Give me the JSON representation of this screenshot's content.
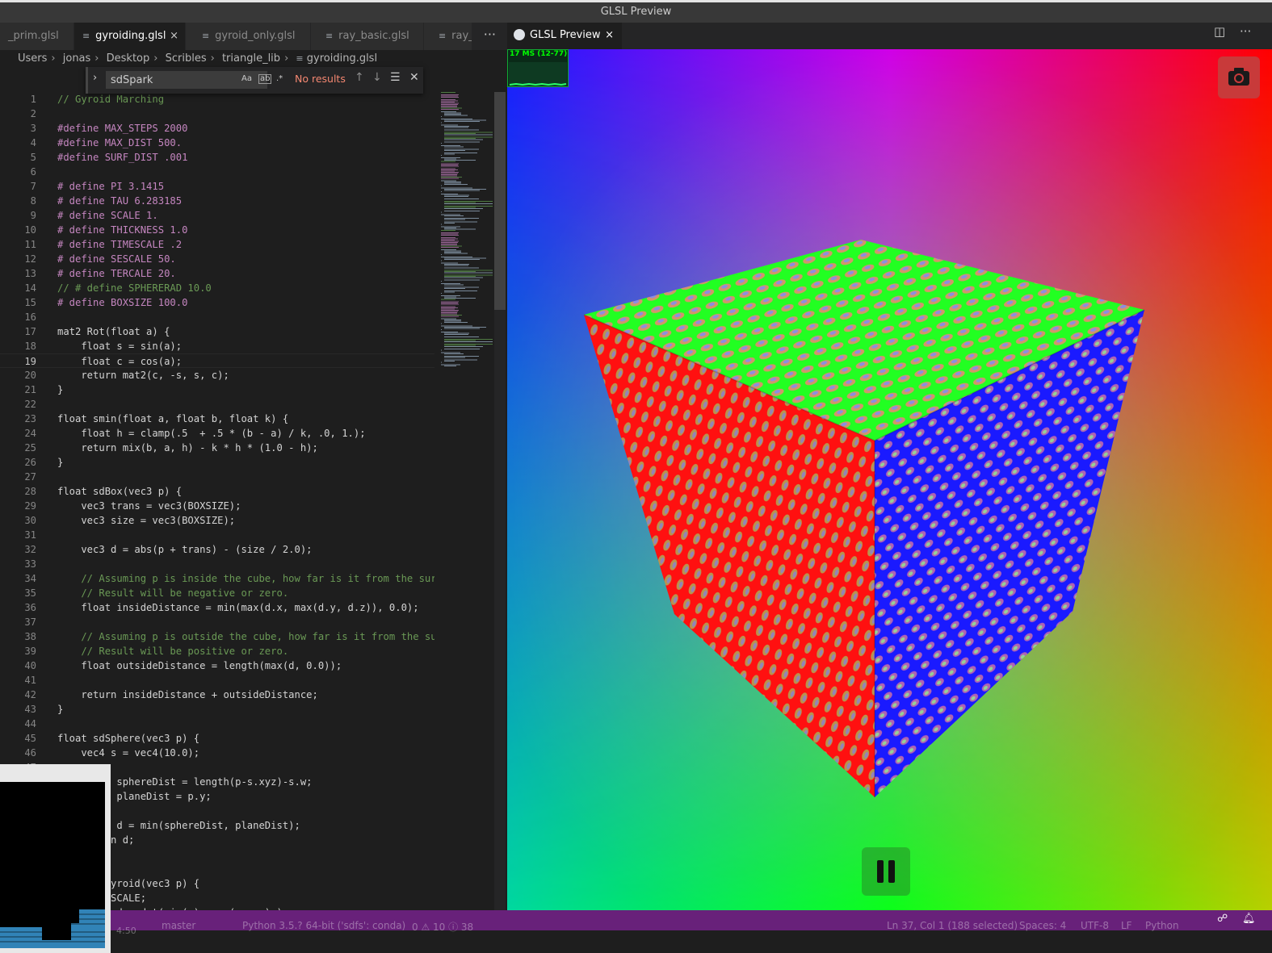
{
  "window": {
    "title": "GLSL Preview"
  },
  "editor": {
    "tabs": [
      {
        "label": "_prim.glsl",
        "active": false
      },
      {
        "label": "gyroiding.glsl",
        "active": true
      },
      {
        "label": "gyroid_only.glsl",
        "active": false
      },
      {
        "label": "ray_basic.glsl",
        "active": false
      },
      {
        "label": "ray_",
        "active": false
      }
    ],
    "tab_close": "×",
    "more": "···",
    "breadcrumb": [
      "Users",
      "jonas",
      "Desktop",
      "Scribles",
      "triangle_lib",
      "gyroiding.glsl"
    ],
    "find": {
      "value": "sdSpark",
      "opt_case": "Aa",
      "opt_word": "ab",
      "opt_regex": ".*",
      "results": "No results",
      "prev": "↑",
      "next": "↓",
      "selection": "☰",
      "close": "✕"
    },
    "current_line": 19,
    "lines": [
      "// Gyroid Marching",
      "",
      "#define MAX_STEPS 2000",
      "#define MAX_DIST 500.",
      "#define SURF_DIST .001",
      "",
      "# define PI 3.1415",
      "# define TAU 6.283185",
      "# define SCALE 1.",
      "# define THICKNESS 1.0",
      "# define TIMESCALE .2",
      "# define SESCALE 50.",
      "# define TERCALE 20.",
      "// # define SPHERERAD 10.0",
      "# define BOXSIZE 100.0",
      "",
      "mat2 Rot(float a) {",
      "    float s = sin(a);",
      "    float c = cos(a);",
      "    return mat2(c, -s, s, c);",
      "}",
      "",
      "float smin(float a, float b, float k) {",
      "    float h = clamp(.5  + .5 * (b - a) / k, .0, 1.);",
      "    return mix(b, a, h) - k * h * (1.0 - h);",
      "}",
      "",
      "float sdBox(vec3 p) {",
      "    vec3 trans = vec3(BOXSIZE);",
      "    vec3 size = vec3(BOXSIZE);",
      "",
      "    vec3 d = abs(p + trans) - (size / 2.0);",
      "",
      "    // Assuming p is inside the cube, how far is it from the surf",
      "    // Result will be negative or zero.",
      "    float insideDistance = min(max(d.x, max(d.y, d.z)), 0.0);",
      "",
      "    // Assuming p is outside the cube, how far is it from the sur",
      "    // Result will be positive or zero.",
      "    float outsideDistance = length(max(d, 0.0));",
      "",
      "    return insideDistance + outsideDistance;",
      "}",
      "",
      "float sdSphere(vec3 p) {",
      "    vec4 s = vec4(10.0);",
      "",
      "    float sphereDist = length(p-s.xyz)-s.w;",
      "    float planeDist = p.y;",
      "",
      "    float d = min(sphereDist, planeDist);",
      "    return d;",
      "}",
      "",
      "float sdGyroid(vec3 p) {",
      "    p *= SCALE;",
      "    float d = dot(sin(p), cos(p.yzx) );"
    ]
  },
  "overlay": {
    "time": "4:50"
  },
  "statusbar": {
    "branch": "master",
    "python": "Python 3.5.? 64-bit ('sdfs': conda)",
    "problems": "0 ⚠ 10 ⓘ 38",
    "position": "Ln 37, Col 1 (188 selected)",
    "spaces": "Spaces: 4",
    "encoding": "UTF-8",
    "eol": "LF",
    "language": "Python"
  },
  "preview": {
    "tab_label": "GLSL Preview",
    "tab_close": "×",
    "split_icon": "split-editor-icon",
    "more": "···",
    "fps": "17 MS (12-77)",
    "camera_icon": "camera-icon",
    "pause_icon": "pause-icon"
  }
}
